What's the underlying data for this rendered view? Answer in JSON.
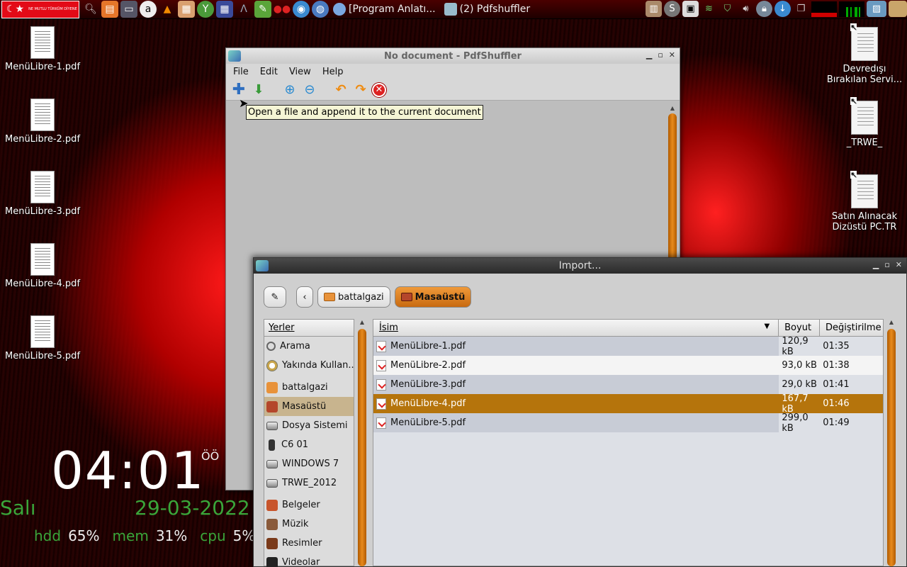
{
  "panel": {
    "flag_text": "NE MUTLU TÜRKÜM DİYENE",
    "tasks": [
      {
        "label": "[Program Anlatı..."
      },
      {
        "label": "(2) Pdfshuffler"
      }
    ],
    "colors": {
      "panel_bg": "#2a0000",
      "accent": "#e30a17"
    }
  },
  "desktop": {
    "left_icons": [
      {
        "label": "MenüLibre-1.pdf"
      },
      {
        "label": "MenüLibre-2.pdf"
      },
      {
        "label": "MenüLibre-3.pdf"
      },
      {
        "label": "MenüLibre-4.pdf"
      },
      {
        "label": "MenüLibre-5.pdf"
      }
    ],
    "right_icons": [
      {
        "label": "Devredışı Bırakılan Servi..."
      },
      {
        "label": "_TRWE_"
      },
      {
        "label": "Satın Alınacak Dizüstü PC.TR"
      }
    ]
  },
  "conky": {
    "time": "04:01",
    "ampm": "ÖÖ",
    "day": "Salı",
    "date": "29-03-2022",
    "hdd_label": "hdd",
    "hdd_value": "65%",
    "mem_label": "mem",
    "mem_value": "31%",
    "cpu_label": "cpu",
    "cpu_value": "5%"
  },
  "pdfshuffler": {
    "title": "No document - PdfShuffler",
    "menu": [
      "File",
      "Edit",
      "View",
      "Help"
    ],
    "tooltip": "Open a file and append it to the current document"
  },
  "import_dialog": {
    "title": "Import...",
    "path": [
      {
        "label": "battalgazi"
      },
      {
        "label": "Masaüstü"
      }
    ],
    "places_header": "Yerler",
    "places": [
      {
        "label": "Arama",
        "icon": "search-icon"
      },
      {
        "label": "Yakında Kullan...",
        "icon": "recent-icon"
      },
      {
        "label": "battalgazi",
        "icon": "home-folder-icon"
      },
      {
        "label": "Masaüstü",
        "icon": "desktop-folder-icon"
      },
      {
        "label": "Dosya Sistemi",
        "icon": "drive-icon"
      },
      {
        "label": "C6 01",
        "icon": "phone-icon"
      },
      {
        "label": "WINDOWS 7",
        "icon": "drive-icon"
      },
      {
        "label": "TRWE_2012",
        "icon": "drive-icon"
      },
      {
        "label": "Belgeler",
        "icon": "documents-folder-icon"
      },
      {
        "label": "Müzik",
        "icon": "music-folder-icon"
      },
      {
        "label": "Resimler",
        "icon": "pictures-folder-icon"
      },
      {
        "label": "Videolar",
        "icon": "video-folder-icon"
      }
    ],
    "columns": {
      "name": "İsim",
      "size": "Boyut",
      "modified": "Değiştirilme"
    },
    "files": [
      {
        "name": "MenüLibre-1.pdf",
        "size": "120,9 kB",
        "modified": "01:35"
      },
      {
        "name": "MenüLibre-2.pdf",
        "size": "93,0 kB",
        "modified": "01:38"
      },
      {
        "name": "MenüLibre-3.pdf",
        "size": "29,0 kB",
        "modified": "01:41"
      },
      {
        "name": "MenüLibre-4.pdf",
        "size": "167,7 kB",
        "modified": "01:46"
      },
      {
        "name": "MenüLibre-5.pdf",
        "size": "299,0 kB",
        "modified": "01:49"
      }
    ],
    "selected_index": 3,
    "colors": {
      "selection": "#b5740c",
      "scrollbar": "#e88a1c"
    }
  }
}
